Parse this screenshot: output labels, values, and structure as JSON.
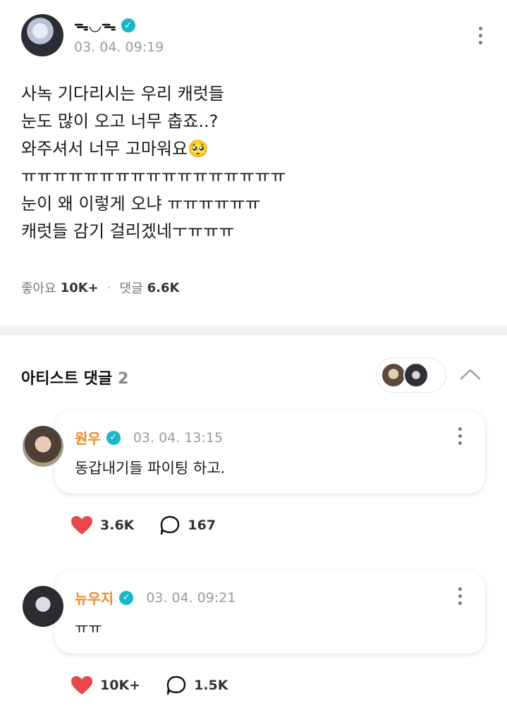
{
  "post": {
    "author": "ᯓ◡ᯓ",
    "verified_mark": "✓",
    "time": "03. 04. 09:19",
    "body_lines": [
      "사녹 기다리시는 우리 캐럿들",
      "눈도 많이 오고 너무 춥죠..?",
      "와주셔서 너무 고마워요🥺",
      "ㅠㅠㅠㅠㅠㅠㅠㅠㅠㅠㅠㅠㅠㅠㅠㅠㅠ",
      "눈이 왜 이렇게 오냐 ㅠㅠㅠㅠㅠㅠ",
      "캐럿들 감기 걸리겠네ㅜㅠㅠㅠ"
    ],
    "likes_label": "좋아요",
    "likes_value": "10K+",
    "comments_label": "댓글",
    "comments_value": "6.6K"
  },
  "artist_comments": {
    "title": "아티스트 댓글",
    "count": "2",
    "items": [
      {
        "name": "원우",
        "time": "03. 04. 13:15",
        "text": "동갑내기들 파이팅 하고.",
        "likes": "3.6K",
        "replies": "167"
      },
      {
        "name": "뉴우지",
        "time": "03. 04. 09:21",
        "text": "ㅠㅠ",
        "likes": "10K+",
        "replies": "1.5K"
      }
    ]
  },
  "colors": {
    "accent_name": "#f08a24",
    "verified": "#18b8c8",
    "heart": "#e8474b"
  }
}
